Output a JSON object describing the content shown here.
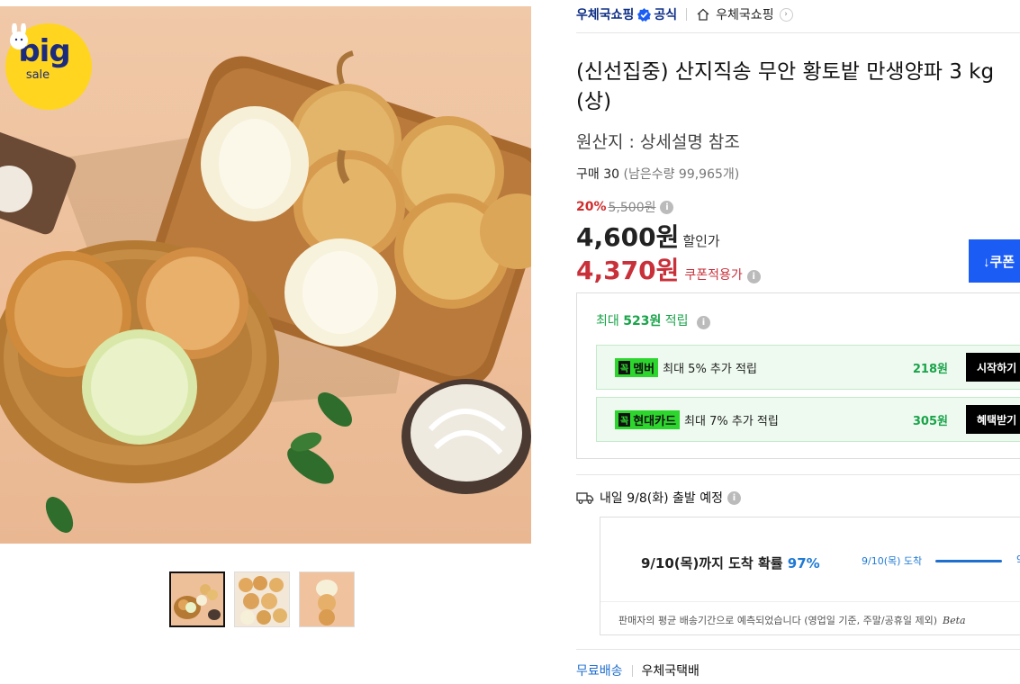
{
  "badge": {
    "big": "big",
    "sale": "sale"
  },
  "store": {
    "name": "우체국쇼핑",
    "official": "공식",
    "home_name": "우체국쇼핑"
  },
  "product": {
    "title": "(신선집중) 산지직송 무안 황토밭 만생양파 3 kg (상)",
    "origin": "원산지 : 상세설명 참조",
    "buy_count": "구매 30",
    "remaining": "(남은수량 99,965개)"
  },
  "pricing": {
    "discount_rate": "20%",
    "original_price": "5,500원",
    "sale_price": "4,600원",
    "sale_label": "할인가",
    "coupon_price": "4,370원",
    "coupon_label": "쿠폰적용가",
    "coupon_button": "↓쿠폰"
  },
  "points": {
    "title_prefix": "최대 ",
    "title_amount": "523원",
    "title_suffix": " 적립",
    "promos": [
      {
        "check": "꼭",
        "tag": "멤버",
        "text": "최대 5% 추가 적립",
        "amount": "218원",
        "button": "시작하기"
      },
      {
        "check": "꼭",
        "tag": "현대카드",
        "text": "최대 7% 추가 적립",
        "amount": "305원",
        "button": "혜택받기"
      }
    ]
  },
  "shipping": {
    "departure": "내일 9/8(화) 출발 예정",
    "arrival_prefix": "9/10(목)까지 도착 확률 ",
    "arrival_percent": "97%",
    "mini_label": "9/10(목) 도착",
    "mini_next": "9",
    "footnote": "판매자의 평균 배송기간으로 예측되었습니다 (영업일 기준, 주말/공휴일 제외)",
    "beta": "Beta",
    "free_shipping": "무료배송",
    "carrier": "우체국택배"
  },
  "colors": {
    "brand_blue": "#0e2e86",
    "coupon_red": "#c8303a",
    "points_green": "#19a34a",
    "coupon_button": "#1b5cf5"
  }
}
